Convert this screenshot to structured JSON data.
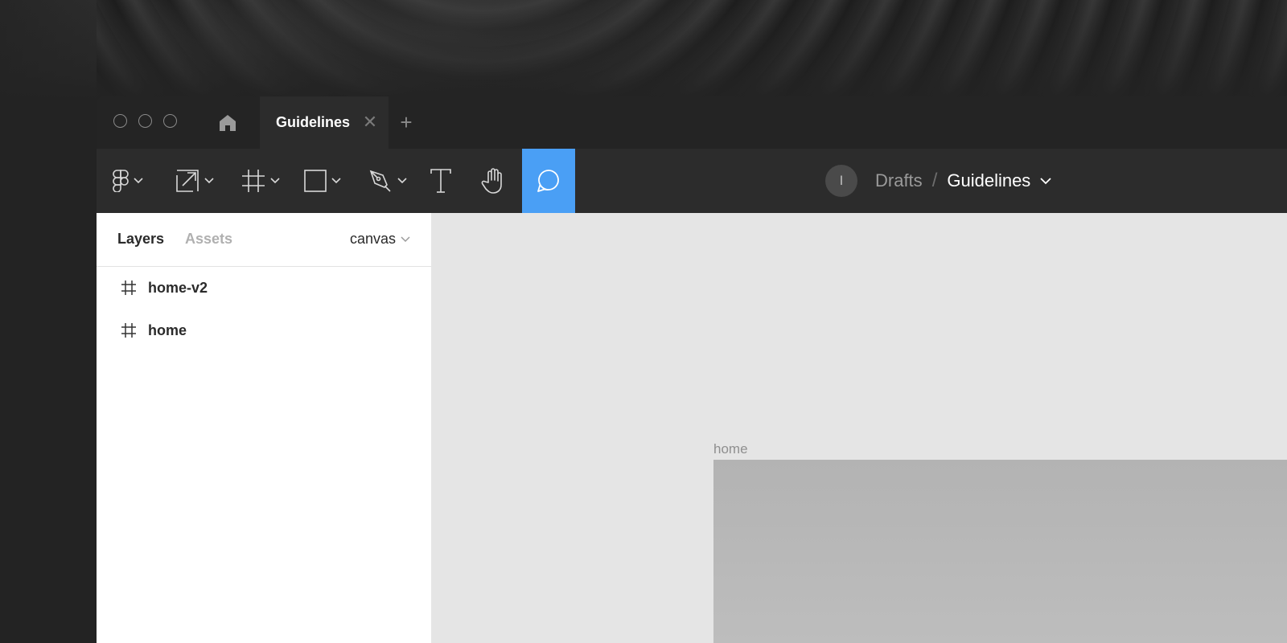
{
  "window": {
    "tabs": [
      {
        "label": "Guidelines",
        "active": true
      }
    ],
    "new_tab_glyph": "+",
    "close_glyph": "✕"
  },
  "toolbar": {
    "tools": [
      {
        "name": "main-menu",
        "icon": "figma-logo-icon",
        "has_dropdown": true
      },
      {
        "name": "move",
        "icon": "move-scale-icon",
        "has_dropdown": true
      },
      {
        "name": "frame",
        "icon": "frame-hash-icon",
        "has_dropdown": true
      },
      {
        "name": "shape",
        "icon": "rectangle-icon",
        "has_dropdown": true
      },
      {
        "name": "pen",
        "icon": "pen-icon",
        "has_dropdown": true
      },
      {
        "name": "text",
        "icon": "text-icon",
        "has_dropdown": false
      },
      {
        "name": "hand",
        "icon": "hand-icon",
        "has_dropdown": false
      },
      {
        "name": "comment",
        "icon": "comment-bubble-icon",
        "has_dropdown": false,
        "active": true
      }
    ],
    "avatar_initial": "I",
    "breadcrumb": {
      "parent": "Drafts",
      "separator": "/",
      "file": "Guidelines"
    }
  },
  "sidebar": {
    "tabs": {
      "layers": "Layers",
      "assets": "Assets"
    },
    "page_selector": "canvas",
    "layers": [
      {
        "label": "home-v2",
        "icon": "frame-hash-icon"
      },
      {
        "label": "home",
        "icon": "frame-hash-icon"
      }
    ]
  },
  "canvas": {
    "frame_title": "home"
  },
  "colors": {
    "accent": "#4a9ff5",
    "toolbar_bg": "#2c2c2c",
    "tabbar_bg": "#242424",
    "canvas_bg": "#e5e5e5",
    "frame_fill": "#b3b3b3"
  }
}
